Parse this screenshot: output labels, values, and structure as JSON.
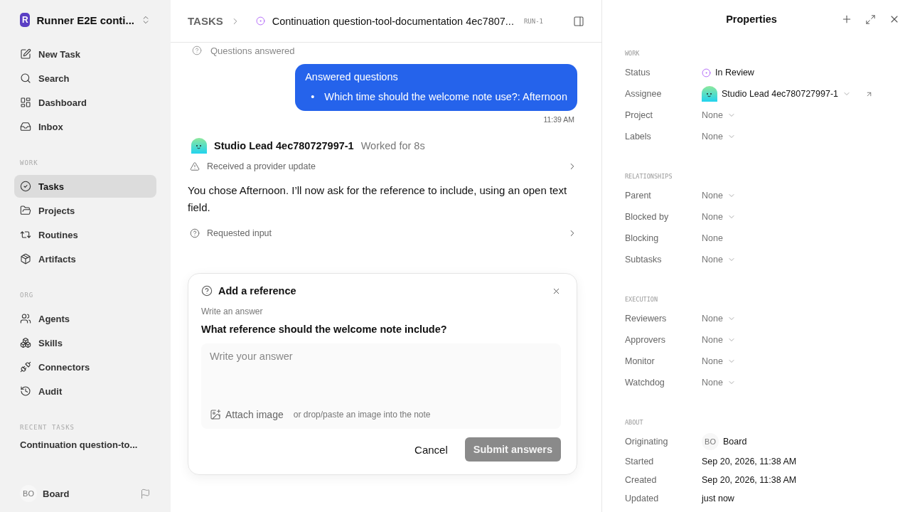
{
  "workspace": {
    "initial": "R",
    "name": "Runner E2E conti..."
  },
  "nav": [
    {
      "label": "New Task",
      "selected": false
    },
    {
      "label": "Search",
      "selected": false
    },
    {
      "label": "Dashboard",
      "selected": false
    },
    {
      "label": "Inbox",
      "selected": false
    }
  ],
  "sections": [
    {
      "title": "WORK",
      "items": [
        {
          "label": "Tasks",
          "selected": true
        },
        {
          "label": "Projects",
          "selected": false
        },
        {
          "label": "Routines",
          "selected": false
        },
        {
          "label": "Artifacts",
          "selected": false
        }
      ]
    },
    {
      "title": "ORG",
      "items": [
        {
          "label": "Agents",
          "selected": false
        },
        {
          "label": "Skills",
          "selected": false
        },
        {
          "label": "Connectors",
          "selected": false
        },
        {
          "label": "Audit",
          "selected": false
        }
      ]
    }
  ],
  "recent": {
    "title": "RECENT TASKS",
    "items": [
      "Continuation question-to..."
    ]
  },
  "user": {
    "initials": "BO",
    "name": "Board"
  },
  "header": {
    "crumb": "TASKS",
    "title": "Continuation question-tool-documentation 4ec7807...",
    "run": "RUN-1"
  },
  "feed": {
    "clipped_event": "Questions answered",
    "message": {
      "title": "Answered questions",
      "bullet": "•",
      "bullets": [
        "Which time should the welcome note use?: Afternoon"
      ],
      "time": "11:39 AM"
    },
    "agent": {
      "name": "Studio Lead 4ec780727997-1",
      "worked": "Worked for 8s"
    },
    "events": [
      {
        "kind": "warning",
        "text": "Received a provider update"
      }
    ],
    "reply": "You chose Afternoon. I’ll now ask for the reference to include, using an open text field.",
    "events_after": [
      {
        "kind": "question",
        "text": "Requested input"
      }
    ]
  },
  "question_card": {
    "title": "Add a reference",
    "hint": "Write an answer",
    "question": "What reference should the welcome note include?",
    "placeholder": "Write your answer",
    "attach": "Attach image",
    "attach_hint": "or drop/paste an image into the note",
    "cancel": "Cancel",
    "submit": "Submit answers",
    "submit_disabled": true
  },
  "properties": {
    "title": "Properties",
    "groups": [
      {
        "title": "WORK",
        "rows": [
          {
            "label": "Status",
            "kind": "status",
            "value": "In Review"
          },
          {
            "label": "Assignee",
            "kind": "agent",
            "value": "Studio Lead 4ec780727997-1"
          },
          {
            "label": "Project",
            "kind": "select",
            "value": "None"
          },
          {
            "label": "Labels",
            "kind": "select",
            "value": "None"
          }
        ]
      },
      {
        "title": "RELATIONSHIPS",
        "rows": [
          {
            "label": "Parent",
            "kind": "select",
            "value": "None"
          },
          {
            "label": "Blocked by",
            "kind": "select",
            "value": "None"
          },
          {
            "label": "Blocking",
            "kind": "muted",
            "value": "None"
          },
          {
            "label": "Subtasks",
            "kind": "select",
            "value": "None"
          }
        ]
      },
      {
        "title": "EXECUTION",
        "rows": [
          {
            "label": "Reviewers",
            "kind": "select",
            "value": "None"
          },
          {
            "label": "Approvers",
            "kind": "select",
            "value": "None"
          },
          {
            "label": "Monitor",
            "kind": "select",
            "value": "None"
          },
          {
            "label": "Watchdog",
            "kind": "select",
            "value": "None"
          }
        ]
      },
      {
        "title": "ABOUT",
        "rows": [
          {
            "label": "Originating",
            "kind": "user",
            "initials": "BO",
            "value": "Board"
          },
          {
            "label": "Started",
            "kind": "text",
            "value": "Sep 20, 2026, 11:38 AM"
          },
          {
            "label": "Created",
            "kind": "text",
            "value": "Sep 20, 2026, 11:38 AM"
          },
          {
            "label": "Updated",
            "kind": "text",
            "value": "just now"
          }
        ]
      }
    ]
  }
}
